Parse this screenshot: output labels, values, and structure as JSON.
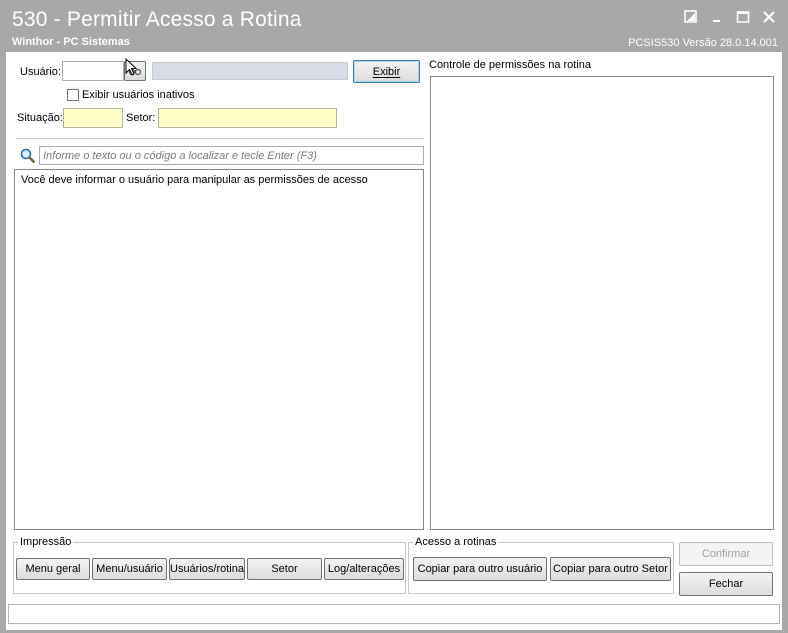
{
  "window": {
    "title": "530 - Permitir Acesso a Rotina",
    "subtitle": "Winthor - PC Sistemas",
    "version": "PCSIS530  Versão  28.0.14.001"
  },
  "form": {
    "usuario_label": "Usuário:",
    "usuario_value": "",
    "usuario_name": "",
    "exibir_button": "Exibir",
    "inactive_checkbox_label": "Exibir usuários inativos",
    "inactive_checked": false,
    "situacao_label": "Situação:",
    "situacao_value": "",
    "setor_label": "Setor:",
    "setor_value": ""
  },
  "search": {
    "placeholder": "Informe o texto ou o código a localizar e tecle Enter (F3)"
  },
  "left_panel": {
    "message": "Você deve informar o usuário para manipular as permissões de acesso"
  },
  "right_panel": {
    "title": "Controle de permissões na rotina"
  },
  "impressao": {
    "title": "Impressão",
    "buttons": [
      "Menu geral",
      "Menu/usuário",
      "Usuários/rotina",
      "Setor",
      "Log/alterações"
    ]
  },
  "acesso": {
    "title": "Acesso a rotinas",
    "buttons": [
      "Copiar para outro usuário",
      "Copiar para outro Setor"
    ]
  },
  "actions": {
    "confirmar": "Confirmar",
    "fechar": "Fechar"
  },
  "status": {
    "text": ""
  }
}
